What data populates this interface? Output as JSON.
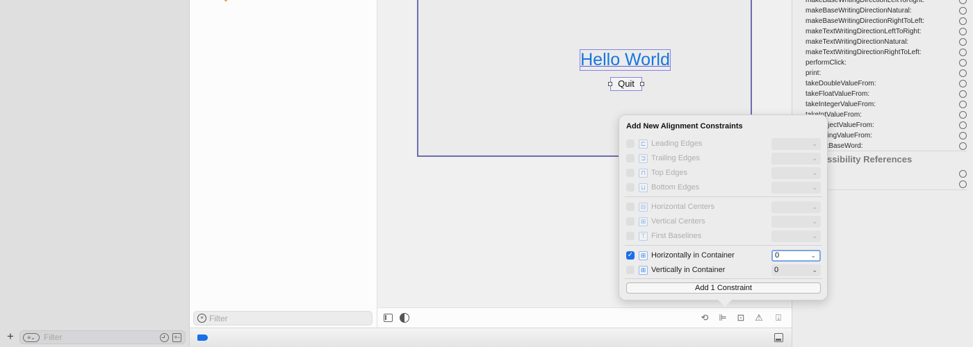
{
  "left_sidebar": {
    "add_label": "+",
    "filter_placeholder": "Filter",
    "filter_menu_glyph": "≡⌄",
    "plusminus_glyph": "+-"
  },
  "navigator": {
    "filter_placeholder": "Filter",
    "filter_glyph": "≡"
  },
  "canvas": {
    "label_text": "Hello World",
    "button_text": "Quit"
  },
  "canvas_toolbar": {
    "icons": [
      {
        "name": "update-frames-icon",
        "glyph": "⟲"
      },
      {
        "name": "align-icon",
        "glyph": "⊫"
      },
      {
        "name": "add-constraints-icon",
        "glyph": "⊡"
      },
      {
        "name": "resolve-issues-icon",
        "glyph": "⚠"
      },
      {
        "name": "embed-in-icon",
        "glyph": "⍗"
      }
    ]
  },
  "inspector": {
    "connections": [
      "makeBaseWritingDirectionLeftToRight:",
      "makeBaseWritingDirectionNatural:",
      "makeBaseWritingDirectionRightToLeft:",
      "makeTextWritingDirectionLeftToRight:",
      "makeTextWritingDirectionNatural:",
      "makeTextWritingDirectionRightToLeft:",
      "performClick:",
      "print:",
      "takeDoubleValueFrom:",
      "takeFloatValueFrom:",
      "takeIntegerValueFrom:",
      "takeIntValueFrom:",
      "takeObjectValueFrom:",
      "takeStringValueFrom:",
      "unmarkBaseWord:"
    ],
    "section_title": "Accessibility References",
    "section_rows": 2
  },
  "popover": {
    "title": "Add New Alignment Constraints",
    "groups": [
      [
        {
          "label": "Leading Edges",
          "checked": false,
          "enabled": false,
          "value": "",
          "icon": "⊏"
        },
        {
          "label": "Trailing Edges",
          "checked": false,
          "enabled": false,
          "value": "",
          "icon": "⊐"
        },
        {
          "label": "Top Edges",
          "checked": false,
          "enabled": false,
          "value": "",
          "icon": "⊓"
        },
        {
          "label": "Bottom Edges",
          "checked": false,
          "enabled": false,
          "value": "",
          "icon": "⊔"
        }
      ],
      [
        {
          "label": "Horizontal Centers",
          "checked": false,
          "enabled": false,
          "value": "",
          "icon": "⊟"
        },
        {
          "label": "Vertical Centers",
          "checked": false,
          "enabled": false,
          "value": "",
          "icon": "⊞"
        },
        {
          "label": "First Baselines",
          "checked": false,
          "enabled": false,
          "value": "",
          "icon": "⊤"
        }
      ],
      [
        {
          "label": "Horizontally in Container",
          "checked": true,
          "enabled": true,
          "value": "0",
          "icon": "⊞",
          "focused": true
        },
        {
          "label": "Vertically in Container",
          "checked": false,
          "enabled": true,
          "value": "0",
          "icon": "⊞"
        }
      ]
    ],
    "add_button_label": "Add 1 Constraint",
    "check_glyph": "✓",
    "chevron_glyph": "⌄"
  },
  "colors": {
    "accent": "#1c6ee8",
    "frame": "#6d6cb0",
    "label_text": "#1776e0"
  }
}
